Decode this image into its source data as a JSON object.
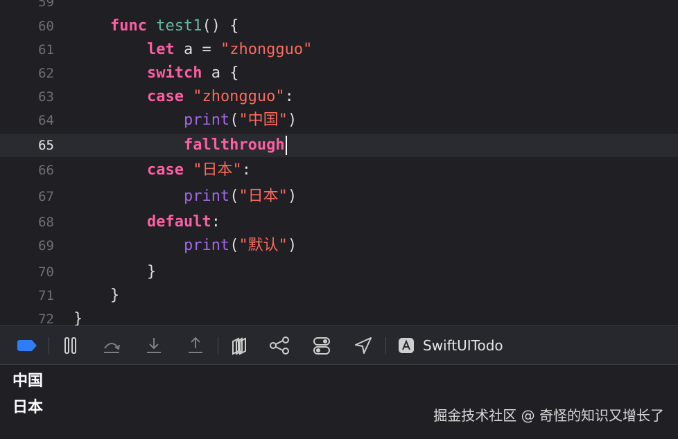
{
  "editor": {
    "lines": [
      {
        "n": "59",
        "segs": []
      },
      {
        "n": "60",
        "segs": [
          [
            "    ",
            ""
          ],
          [
            "func",
            "kw"
          ],
          [
            " ",
            ""
          ],
          [
            "test1",
            "fn"
          ],
          [
            "() {",
            ""
          ]
        ]
      },
      {
        "n": "61",
        "segs": [
          [
            "        ",
            ""
          ],
          [
            "let",
            "kw"
          ],
          [
            " a = ",
            ""
          ],
          [
            "\"zhongguo\"",
            "str"
          ]
        ]
      },
      {
        "n": "62",
        "segs": [
          [
            "        ",
            ""
          ],
          [
            "switch",
            "kw"
          ],
          [
            " a {",
            ""
          ]
        ]
      },
      {
        "n": "63",
        "segs": [
          [
            "        ",
            ""
          ],
          [
            "case",
            "kw"
          ],
          [
            " ",
            ""
          ],
          [
            "\"zhongguo\"",
            "str"
          ],
          [
            ":",
            ""
          ]
        ]
      },
      {
        "n": "64",
        "segs": [
          [
            "            ",
            ""
          ],
          [
            "print",
            "call"
          ],
          [
            "(",
            ""
          ],
          [
            "\"中国\"",
            "str"
          ],
          [
            ")",
            ""
          ]
        ]
      },
      {
        "n": "65",
        "current": true,
        "segs": [
          [
            "            ",
            ""
          ],
          [
            "fallthrough",
            "kw"
          ]
        ]
      },
      {
        "n": "66",
        "segs": [
          [
            "        ",
            ""
          ],
          [
            "case",
            "kw"
          ],
          [
            " ",
            ""
          ],
          [
            "\"日本\"",
            "str"
          ],
          [
            ":",
            ""
          ]
        ]
      },
      {
        "n": "67",
        "segs": [
          [
            "            ",
            ""
          ],
          [
            "print",
            "call"
          ],
          [
            "(",
            ""
          ],
          [
            "\"日本\"",
            "str"
          ],
          [
            ")",
            ""
          ]
        ]
      },
      {
        "n": "68",
        "segs": [
          [
            "        ",
            ""
          ],
          [
            "default",
            "kw"
          ],
          [
            ":",
            ""
          ]
        ]
      },
      {
        "n": "69",
        "segs": [
          [
            "            ",
            ""
          ],
          [
            "print",
            "call"
          ],
          [
            "(",
            ""
          ],
          [
            "\"默认\"",
            "str"
          ],
          [
            ")",
            ""
          ]
        ]
      },
      {
        "n": "70",
        "segs": [
          [
            "        }",
            ""
          ]
        ]
      },
      {
        "n": "71",
        "segs": [
          [
            "    }",
            ""
          ]
        ]
      },
      {
        "n": "72",
        "segs": [
          [
            "}",
            ""
          ]
        ]
      }
    ]
  },
  "debug_bar": {
    "scheme": "SwiftUITodo",
    "accent": "#2f7df6"
  },
  "console": {
    "output": [
      "中国",
      "日本"
    ]
  },
  "watermark": "掘金技术社区 @ 奇怪的知识又增长了"
}
